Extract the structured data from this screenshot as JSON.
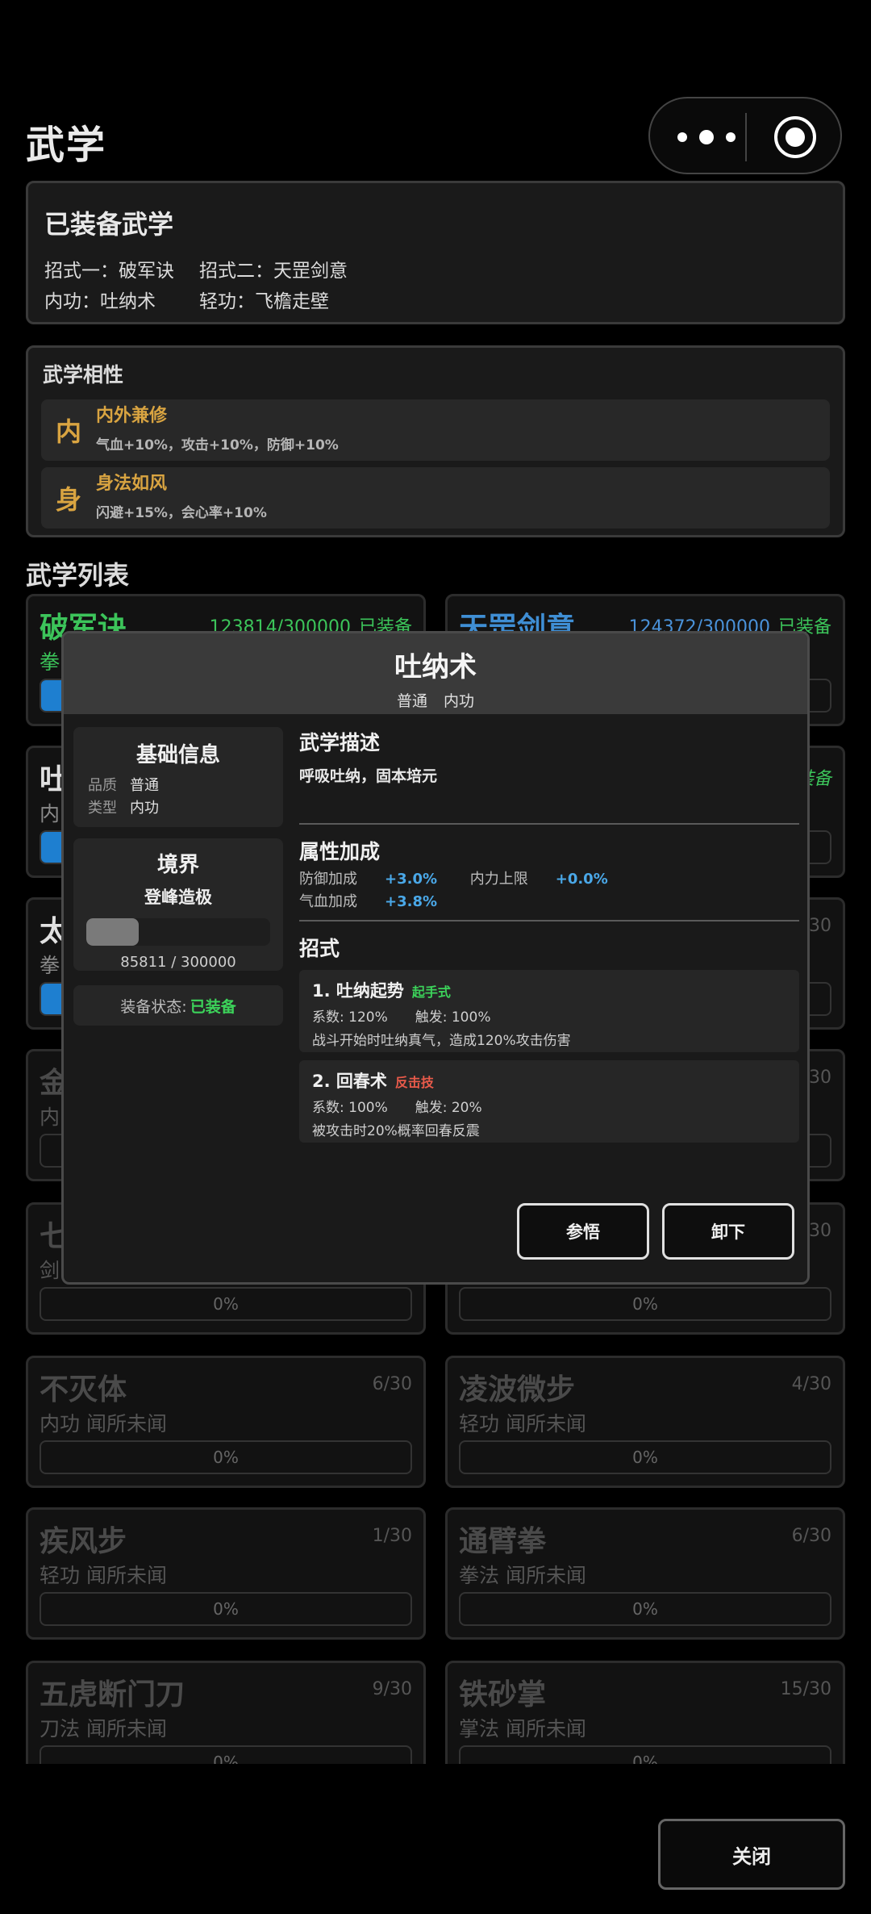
{
  "header": {
    "title": "武学"
  },
  "equipped": {
    "title": "已装备武学",
    "move1_label": "招式一：破军诀",
    "move2_label": "招式二：天罡剑意",
    "inner_label": "内功：吐纳术",
    "light_label": "轻功：飞檐走壁"
  },
  "affinity": {
    "title": "武学相性",
    "items": [
      {
        "icon": "内",
        "name": "内外兼修",
        "desc": "气血+10%，攻击+10%，防御+10%"
      },
      {
        "icon": "身",
        "name": "身法如风",
        "desc": "闪避+15%，会心率+10%"
      }
    ]
  },
  "list": {
    "title": "武学列表",
    "cards": [
      {
        "name": "破军诀",
        "count": "123814/300000",
        "equip": "已装备",
        "sub": "拳",
        "progress": 0.06,
        "pct": ""
      },
      {
        "name": "天罡剑意",
        "count": "124372/300000",
        "equip": "已装备",
        "sub": "",
        "progress": 0,
        "pct": ""
      },
      {
        "name": "吐",
        "count": "",
        "equip": "",
        "sub": "内",
        "progress": 0.06,
        "pct": ""
      },
      {
        "name": "",
        "count": "",
        "equip": "装备",
        "sub": "",
        "progress": 0,
        "pct": ""
      },
      {
        "name": "太",
        "count": "",
        "equip": "",
        "sub": "拳",
        "progress": 0.06,
        "pct": ""
      },
      {
        "name": "",
        "count": "/30",
        "equip": "",
        "sub": "",
        "progress": 0,
        "pct": ""
      },
      {
        "name": "金",
        "count": "",
        "equip": "",
        "sub": "内",
        "progress": 0,
        "pct": ""
      },
      {
        "name": "",
        "count": "/30",
        "equip": "",
        "sub": "",
        "progress": 0,
        "pct": ""
      },
      {
        "name": "七",
        "count": "",
        "equip": "",
        "sub": "剑",
        "progress": 0,
        "pct": "0%"
      },
      {
        "name": "",
        "count": "/30",
        "equip": "",
        "sub": "",
        "progress": 0,
        "pct": "0%"
      },
      {
        "name": "不灭体",
        "count": "6/30",
        "sub": "内功 闻所未闻",
        "progress": 0,
        "pct": "0%"
      },
      {
        "name": "凌波微步",
        "count": "4/30",
        "sub": "轻功 闻所未闻",
        "progress": 0,
        "pct": "0%"
      },
      {
        "name": "疾风步",
        "count": "1/30",
        "sub": "轻功 闻所未闻",
        "progress": 0,
        "pct": "0%"
      },
      {
        "name": "通臂拳",
        "count": "6/30",
        "sub": "拳法 闻所未闻",
        "progress": 0,
        "pct": "0%"
      },
      {
        "name": "五虎断门刀",
        "count": "9/30",
        "sub": "刀法 闻所未闻",
        "progress": 0,
        "pct": "0%"
      },
      {
        "name": "铁砂掌",
        "count": "15/30",
        "sub": "掌法 闻所未闻",
        "progress": 0,
        "pct": "0%"
      }
    ]
  },
  "modal": {
    "title": "吐纳术",
    "quality": "普通",
    "type": "内功",
    "basic": {
      "title": "基础信息",
      "quality_label": "品质",
      "quality_value": "普通",
      "type_label": "类型",
      "type_value": "内功"
    },
    "realm": {
      "title": "境界",
      "level": "登峰造极",
      "progress": 0.286,
      "progress_text": "85811 / 300000"
    },
    "status": {
      "label": "装备状态:",
      "value": "已装备"
    },
    "desc_title": "武学描述",
    "desc": "呼吸吐纳，固本培元",
    "attr_title": "属性加成",
    "attrs": {
      "def_label": "防御加成",
      "def_value": "+3.0%",
      "mp_label": "内力上限",
      "mp_value": "+0.0%",
      "hp_label": "气血加成",
      "hp_value": "+3.8%"
    },
    "moves_title": "招式",
    "moves": [
      {
        "name": "1. 吐纳起势",
        "tag": "起手式",
        "coef": "系数: 120%",
        "trigger": "触发: 100%",
        "desc": "战斗开始时吐纳真气，造成120%攻击伤害"
      },
      {
        "name": "2. 回春术",
        "tag": "反击技",
        "coef": "系数: 100%",
        "trigger": "触发: 20%",
        "desc": "被攻击时20%概率回春反震"
      }
    ],
    "btn_comprehend": "参悟",
    "btn_unequip": "卸下"
  },
  "footer": {
    "close": "关闭"
  },
  "colors": {
    "equipped_green": "#3cc45a",
    "blue_name": "#3f8ed4",
    "gold": "#d9a441",
    "attr_blue": "#4aa8e8",
    "red_tag": "#e85a4a"
  }
}
